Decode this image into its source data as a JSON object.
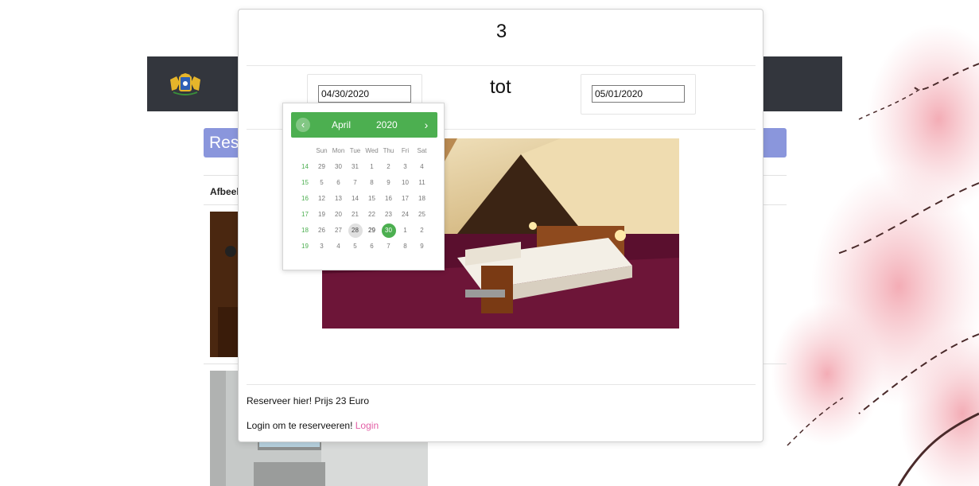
{
  "background": {
    "banner_text": "Res",
    "column_header": "Afbeel"
  },
  "modal": {
    "title": "3",
    "separator_text": "tot",
    "start_date": "04/30/2020",
    "end_date": "05/01/2020",
    "reserve_text": "Reserveer hier! Prijs 23 Euro",
    "login_prompt": "Login om te reserveeren!",
    "login_link": "Login"
  },
  "calendar": {
    "month": "April",
    "year": "2020",
    "prev_icon": "‹",
    "next_icon": "›",
    "weekdays": [
      "Sun",
      "Mon",
      "Tue",
      "Wed",
      "Thu",
      "Fri",
      "Sat"
    ],
    "weeks": [
      {
        "week": "14",
        "days": [
          "29",
          "30",
          "31",
          "1",
          "2",
          "3",
          "4"
        ]
      },
      {
        "week": "15",
        "days": [
          "5",
          "6",
          "7",
          "8",
          "9",
          "10",
          "11"
        ]
      },
      {
        "week": "16",
        "days": [
          "12",
          "13",
          "14",
          "15",
          "16",
          "17",
          "18"
        ]
      },
      {
        "week": "17",
        "days": [
          "19",
          "20",
          "21",
          "22",
          "23",
          "24",
          "25"
        ]
      },
      {
        "week": "18",
        "days": [
          "26",
          "27",
          "28",
          "29",
          "30",
          "1",
          "2"
        ]
      },
      {
        "week": "19",
        "days": [
          "3",
          "4",
          "5",
          "6",
          "7",
          "8",
          "9"
        ]
      }
    ],
    "selected_day": "30",
    "hovered_day": "28"
  },
  "colors": {
    "calendar_accent": "#4caf50",
    "topbar": "#33363d",
    "banner": "#8a96dc",
    "login_link": "#e35fa6"
  }
}
